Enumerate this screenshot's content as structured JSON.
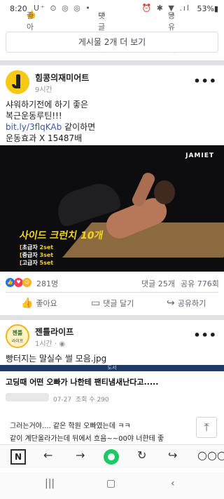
{
  "status_bar": {
    "time": "8:20",
    "left_icons": "U⁺ ⊙ ◎ ◎ •",
    "right_icons": "⏰ ✱ ▼ .ıl",
    "battery": "53%▮"
  },
  "prev_post_actions": {
    "like": "좋아요",
    "comment": "댓글 달기",
    "share": "공유하기"
  },
  "more_comments_button": "게시물 2개 더 보기",
  "post1": {
    "page_name": "힘콩의재미어트",
    "time": "9시간",
    "text_line1": "샤워하기전에 하기 좋은",
    "text_line2": "복근운동루틴!!!",
    "link": "bit.ly/3flqKAb",
    "link_suffix": " 같이하면",
    "text_line4": "운동효과 X 15487배",
    "video": {
      "brand": "JAMIET",
      "headline": "사이드 크런치 10개",
      "levels": [
        {
          "prefix": "[",
          "name": "초급자",
          "reps": "2set"
        },
        {
          "prefix": "[",
          "name": "중급자",
          "reps": "3set"
        },
        {
          "prefix": "[",
          "name": "고급자",
          "reps": "5set"
        }
      ]
    },
    "reaction_count": "281명",
    "comments": "댓글 25개",
    "shares": "공유 776회",
    "actions": {
      "like": "좋아요",
      "comment": "댓글 달기",
      "share": "공유하기"
    }
  },
  "post2": {
    "page_name": "젠틀라이프",
    "time": "1시간",
    "avatar_line1": "젠틀",
    "avatar_line2": "라이프",
    "text": "빵터지는 말실수 썰 모음.jpg",
    "image": {
      "band": "도서",
      "title": "고딩때 어떤 오빠가 나한테 팬티냄새난다고.....",
      "date": "07-27",
      "views": "조회 수 290",
      "line1": "그러는거야.... 같은 학원 오빠였는데 ㅋㅋ",
      "line2": "같이 계단올라가는데 뒤에서 흐음~~00야 너한테 좋"
    }
  },
  "icons": {
    "scroll_top": "arrow-up-icon",
    "browser": [
      "naver-logo-icon",
      "back-icon",
      "forward-icon",
      "green-circle-icon",
      "refresh-icon",
      "share-icon",
      "more-icon"
    ],
    "nav": [
      "recent-apps-icon",
      "home-icon",
      "back-nav-icon"
    ]
  },
  "browser_logo": "N",
  "colors": {
    "link": "#385898",
    "accent_yellow": "#f2d31b",
    "green": "#18c964",
    "like_blue": "#1877f2",
    "love_red": "#f33e58"
  }
}
